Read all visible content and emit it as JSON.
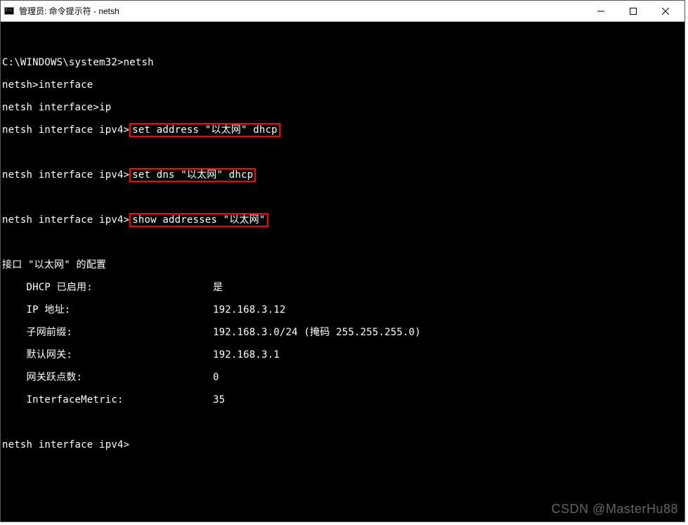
{
  "titlebar": {
    "title": "管理员: 命令提示符 - netsh"
  },
  "terminal": {
    "line1_prompt": "C:\\WINDOWS\\system32>",
    "line1_cmd": "netsh",
    "line2_prompt": "netsh>",
    "line2_cmd": "interface",
    "line3_prompt": "netsh interface>",
    "line3_cmd": "ip",
    "line4_prompt": "netsh interface ipv4>",
    "line4_cmd": "set address \"以太网\" dhcp",
    "line5_prompt": "netsh interface ipv4>",
    "line5_cmd": "set dns \"以太网\" dhcp",
    "line6_prompt": "netsh interface ipv4>",
    "line6_cmd": "show addresses \"以太网\"",
    "config_header": "接口 \"以太网\" 的配置",
    "dhcp_label": "    DHCP 已启用:",
    "dhcp_value": "是",
    "ip_label": "    IP 地址:",
    "ip_value": "192.168.3.12",
    "subnet_label": "    子网前缀:",
    "subnet_value": "192.168.3.0/24 (掩码 255.255.255.0)",
    "gateway_label": "    默认网关:",
    "gateway_value": "192.168.3.1",
    "hops_label": "    网关跃点数:",
    "hops_value": "0",
    "metric_label": "    InterfaceMetric:",
    "metric_value": "35",
    "final_prompt": "netsh interface ipv4>"
  },
  "watermark": "CSDN @MasterHu88"
}
